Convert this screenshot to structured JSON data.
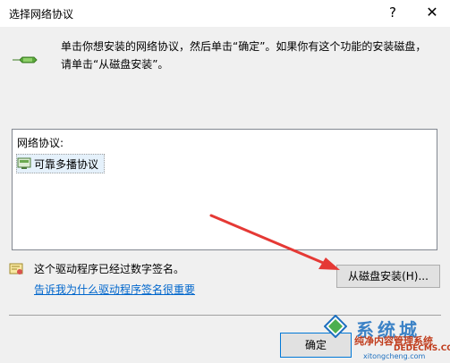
{
  "window": {
    "title": "选择网络协议",
    "help_label": "?",
    "close_label": "✕"
  },
  "instruction": "单击你想安装的网络协议，然后单击“确定”。如果你有这个功能的安装磁盘，请单击“从磁盘安装”。",
  "protocol_list": {
    "header": "网络协议:",
    "items": [
      {
        "label": "可靠多播协议",
        "icon": "network-protocol-icon"
      }
    ]
  },
  "signature": {
    "status_text": "这个驱动程序已经过数字签名。",
    "why_link": "告诉我为什么驱动程序签名很重要",
    "icon": "shield-certificate-icon"
  },
  "buttons": {
    "have_disk": "从磁盘安装(H)...",
    "ok": "确定"
  },
  "annotation": {
    "arrow_color": "#e53935"
  },
  "watermark": {
    "brand": "系统城",
    "subtitle": "纯净内容管理系统",
    "url": "DEDECMS.COM",
    "pinyin": "xitongcheng.com"
  }
}
